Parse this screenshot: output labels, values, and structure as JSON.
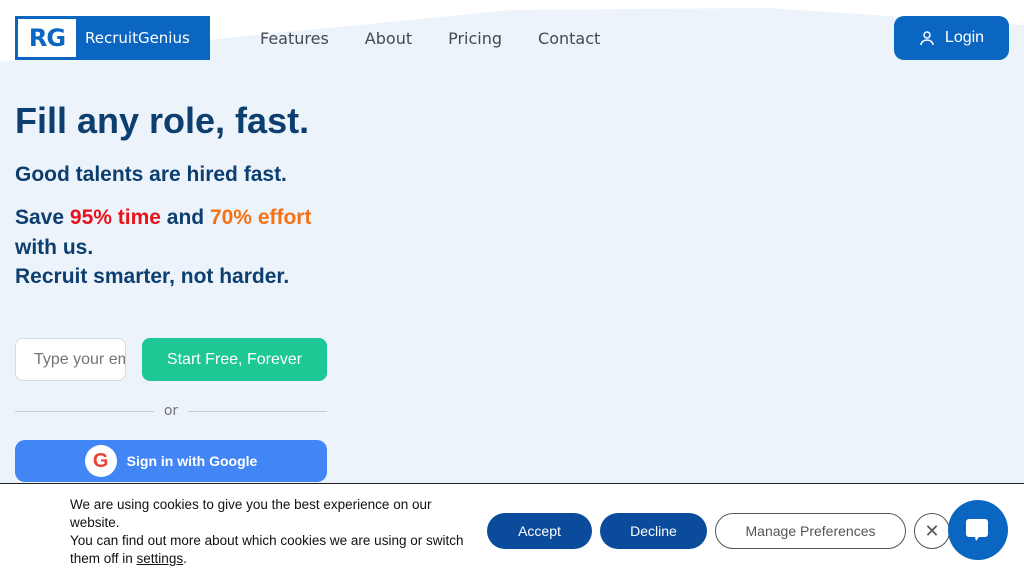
{
  "brand": {
    "mark": "RG",
    "name": "RecruitGenius"
  },
  "nav": [
    "Features",
    "About",
    "Pricing",
    "Contact"
  ],
  "login": "Login",
  "hero": {
    "title": "Fill any role, fast.",
    "subtitle": "Good talents are hired fast.",
    "p1": "Save ",
    "h1": "95% time",
    "p2": " and ",
    "h2": "70% effort",
    "p3": " with us.",
    "line2": "Recruit smarter, not harder."
  },
  "form": {
    "placeholder": "Type your email",
    "start": "Start Free, Forever",
    "or": "or",
    "google": "Sign in with Google"
  },
  "cookie": {
    "l1": "We are using cookies to give you the best experience on our website.",
    "l2": "You can find out more about which cookies we are using or switch them off in ",
    "link": "settings",
    "end": ".",
    "accept": "Accept",
    "decline": "Decline",
    "manage": "Manage Preferences",
    "close": "✕"
  },
  "colors": {
    "primary": "#0b66c2",
    "green": "#1ec894",
    "red": "#e8131b",
    "orange": "#f47216"
  }
}
